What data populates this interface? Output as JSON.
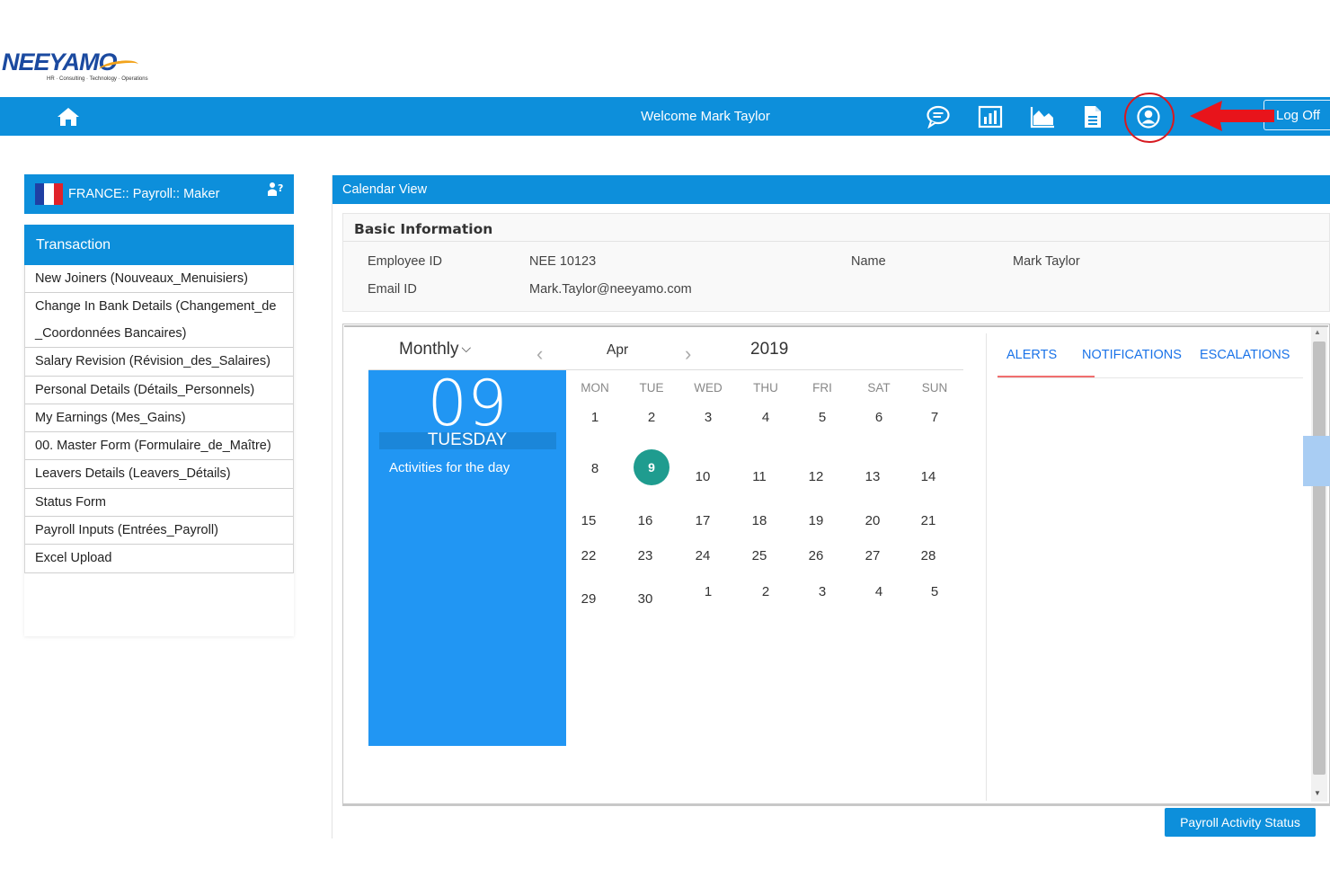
{
  "logo": {
    "text": "NEEYAMO",
    "tagline": "HR · Consulting · Technology · Operations"
  },
  "topbar": {
    "welcome": "Welcome Mark Taylor",
    "logoff_label": "Log Off",
    "icons": [
      "home-icon",
      "chat-icon",
      "report-icon",
      "area-chart-icon",
      "document-icon",
      "user-profile-icon"
    ],
    "color": "#0d8fdb"
  },
  "annotation": {
    "circle_color": "#d71920",
    "arrow_color": "#e8141b"
  },
  "sidebar": {
    "role": "FRANCE:: Payroll:: Maker",
    "section_title": "Transaction",
    "items": [
      "New Joiners (Nouveaux_Menuisiers)",
      "Change In Bank Details (Changement_de _Coordonnées Bancaires)",
      "Salary Revision (Révision_des_Salaires)",
      "Personal Details (Détails_Personnels)",
      "My Earnings (Mes_Gains)",
      "00. Master Form (Formulaire_de_Maître)",
      "Leavers Details (Leavers_Détails)",
      "Status Form",
      "Payroll Inputs (Entrées_Payroll)",
      "Excel Upload"
    ]
  },
  "main": {
    "panel_title": "Calendar View",
    "basic_info": {
      "title": "Basic Information",
      "employee_id_label": "Employee ID",
      "employee_id": "NEE 10123",
      "name_label": "Name",
      "name": "Mark Taylor",
      "email_label": "Email ID",
      "email": "Mark.Taylor@neeyamo.com"
    },
    "calendar": {
      "view": "Monthly",
      "month": "Apr",
      "year": "2019",
      "selected_day": "09",
      "selected_weekday": "TUESDAY",
      "activities_label": "Activities for the day",
      "today": "9",
      "weekdays": [
        "MON",
        "TUE",
        "WED",
        "THU",
        "FRI",
        "SAT",
        "SUN"
      ],
      "weeks": [
        [
          "1",
          "2",
          "3",
          "4",
          "5",
          "6",
          "7"
        ],
        [
          "8",
          "9",
          "10",
          "11",
          "12",
          "13",
          "14"
        ],
        [
          "15",
          "16",
          "17",
          "18",
          "19",
          "20",
          "21"
        ],
        [
          "22",
          "23",
          "24",
          "25",
          "26",
          "27",
          "28"
        ],
        [
          "29",
          "30",
          "1",
          "2",
          "3",
          "4",
          "5"
        ]
      ],
      "accent": "#2196f3",
      "today_color": "#1f9c8f"
    },
    "tabs": [
      "ALERTS",
      "NOTIFICATIONS",
      "ESCALATIONS"
    ],
    "action_button": "Payroll Activity Status"
  }
}
